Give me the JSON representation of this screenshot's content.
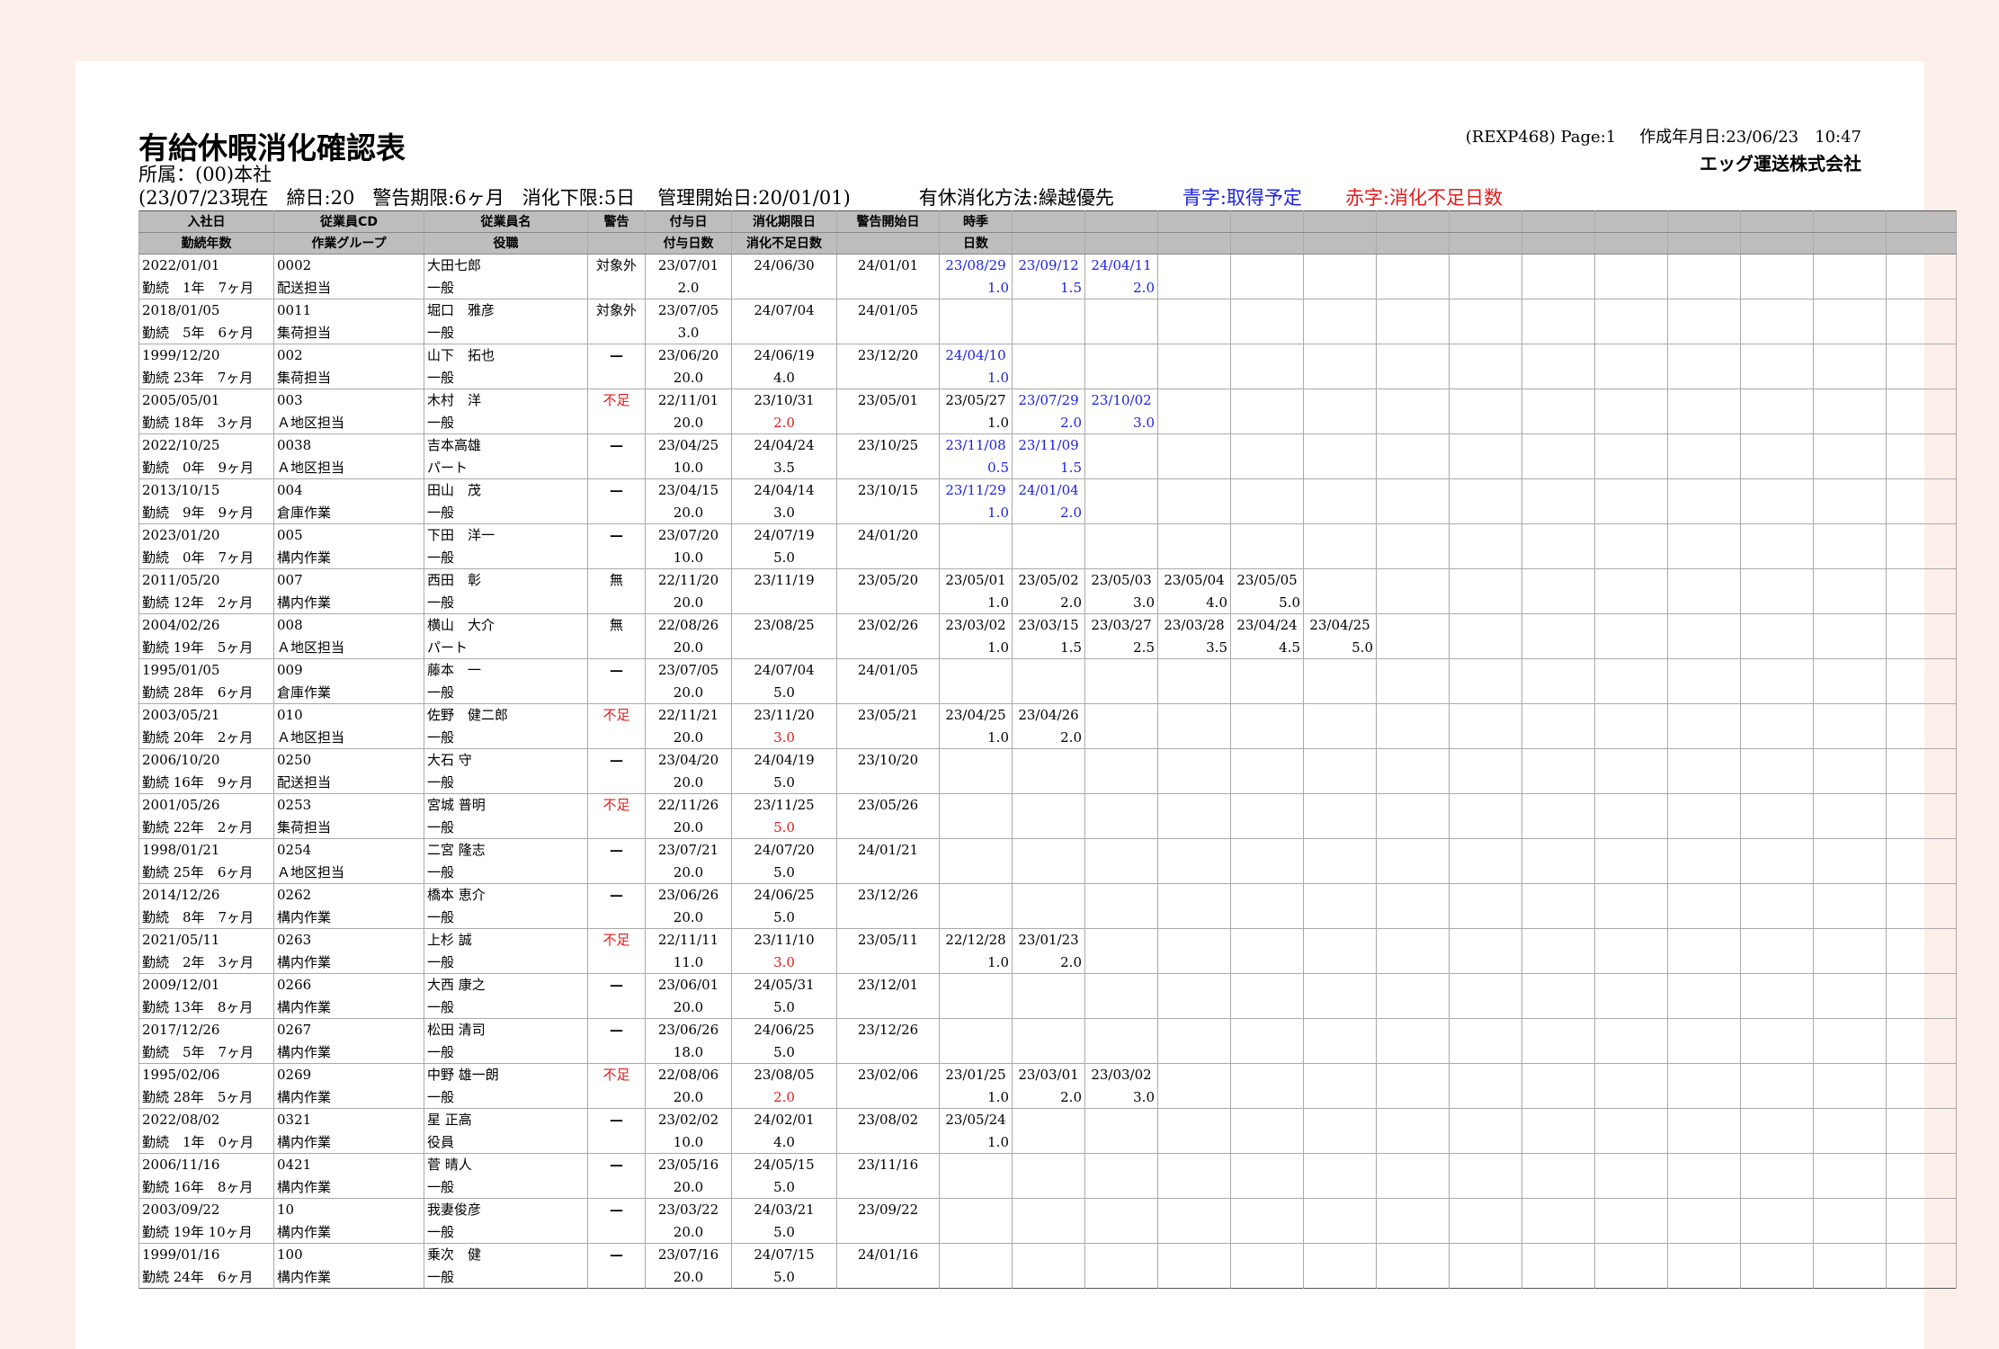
{
  "report": {
    "title": "有給休暇消化確認表",
    "department": "所属：(00)本社",
    "as_of": "(23/07/23現在",
    "closing_day": "締日:20",
    "warning_period": "警告期限:6ヶ月",
    "min_days": "消化下限:5日",
    "mgmt_start": "管理開始日:20/01/01)",
    "method": "有休消化方法:繰越優先",
    "legend_blue": "青字:取得予定",
    "legend_red": "赤字:消化不足日数",
    "report_id": "(REXP468) Page:1",
    "created": "作成年月日:23/06/23　10:47",
    "company": "エッグ運送株式会社",
    "colors": {
      "blue": "#1c22e0",
      "red": "#e11b1b",
      "header_bg": "#bdbdbd",
      "page_bg": "#fcefea"
    }
  },
  "headers": {
    "row1": [
      "入社日",
      "従業員CD",
      "従業員名",
      "警告",
      "付与日",
      "消化期限日",
      "警告開始日",
      "時季"
    ],
    "row2": [
      "勤続年数",
      "作業グループ",
      "役職",
      "",
      "付与日数",
      "消化不足日数",
      "",
      "日数"
    ]
  },
  "employees": [
    {
      "hire": "2022/01/01",
      "tenure": "勤続　1年　7ヶ月",
      "cd": "0002",
      "group": "配送担当",
      "name": "大田七郎",
      "title": "一般",
      "warn": "対象外",
      "warn_type": "text",
      "grant": "23/07/01",
      "grant_days": "2.0",
      "limit": "24/06/30",
      "short": "",
      "short_red": false,
      "wstart": "24/01/01",
      "seasons": [
        {
          "d": "23/08/29",
          "n": "1.0",
          "blue": true
        },
        {
          "d": "23/09/12",
          "n": "1.5",
          "blue": true
        },
        {
          "d": "24/04/11",
          "n": "2.0",
          "blue": true
        }
      ]
    },
    {
      "hire": "2018/01/05",
      "tenure": "勤続　5年　6ヶ月",
      "cd": "0011",
      "group": "集荷担当",
      "name": "堀口　雅彦",
      "title": "一般",
      "warn": "対象外",
      "warn_type": "text",
      "grant": "23/07/05",
      "grant_days": "3.0",
      "limit": "24/07/04",
      "short": "",
      "short_red": false,
      "wstart": "24/01/05",
      "seasons": []
    },
    {
      "hire": "1999/12/20",
      "tenure": "勤続 23年　7ヶ月",
      "cd": "002",
      "group": "集荷担当",
      "name": "山下　拓也",
      "title": "一般",
      "warn": "—",
      "warn_type": "dash",
      "grant": "23/06/20",
      "grant_days": "20.0",
      "limit": "24/06/19",
      "short": "4.0",
      "short_red": false,
      "wstart": "23/12/20",
      "seasons": [
        {
          "d": "24/04/10",
          "n": "1.0",
          "blue": true
        }
      ]
    },
    {
      "hire": "2005/05/01",
      "tenure": "勤続 18年　3ヶ月",
      "cd": "003",
      "group": "Ａ地区担当",
      "name": "木村　洋",
      "title": "一般",
      "warn": "不足",
      "warn_type": "red",
      "grant": "22/11/01",
      "grant_days": "20.0",
      "limit": "23/10/31",
      "short": "2.0",
      "short_red": true,
      "wstart": "23/05/01",
      "seasons": [
        {
          "d": "23/05/27",
          "n": "1.0",
          "blue": false
        },
        {
          "d": "23/07/29",
          "n": "2.0",
          "blue": true
        },
        {
          "d": "23/10/02",
          "n": "3.0",
          "blue": true
        }
      ]
    },
    {
      "hire": "2022/10/25",
      "tenure": "勤続　0年　9ヶ月",
      "cd": "0038",
      "group": "Ａ地区担当",
      "name": "吉本高雄",
      "title": "パート",
      "warn": "—",
      "warn_type": "dash",
      "grant": "23/04/25",
      "grant_days": "10.0",
      "limit": "24/04/24",
      "short": "3.5",
      "short_red": false,
      "wstart": "23/10/25",
      "seasons": [
        {
          "d": "23/11/08",
          "n": "0.5",
          "blue": true
        },
        {
          "d": "23/11/09",
          "n": "1.5",
          "blue": true
        }
      ]
    },
    {
      "hire": "2013/10/15",
      "tenure": "勤続　9年　9ヶ月",
      "cd": "004",
      "group": "倉庫作業",
      "name": "田山　茂",
      "title": "一般",
      "warn": "—",
      "warn_type": "dash",
      "grant": "23/04/15",
      "grant_days": "20.0",
      "limit": "24/04/14",
      "short": "3.0",
      "short_red": false,
      "wstart": "23/10/15",
      "seasons": [
        {
          "d": "23/11/29",
          "n": "1.0",
          "blue": true
        },
        {
          "d": "24/01/04",
          "n": "2.0",
          "blue": true
        }
      ]
    },
    {
      "hire": "2023/01/20",
      "tenure": "勤続　0年　7ヶ月",
      "cd": "005",
      "group": "構内作業",
      "name": "下田　洋一",
      "title": "一般",
      "warn": "—",
      "warn_type": "dash",
      "grant": "23/07/20",
      "grant_days": "10.0",
      "limit": "24/07/19",
      "short": "5.0",
      "short_red": false,
      "wstart": "24/01/20",
      "seasons": []
    },
    {
      "hire": "2011/05/20",
      "tenure": "勤続 12年　2ヶ月",
      "cd": "007",
      "group": "構内作業",
      "name": "西田　彰",
      "title": "一般",
      "warn": "無",
      "warn_type": "text",
      "grant": "22/11/20",
      "grant_days": "20.0",
      "limit": "23/11/19",
      "short": "",
      "short_red": false,
      "wstart": "23/05/20",
      "seasons": [
        {
          "d": "23/05/01",
          "n": "1.0",
          "blue": false
        },
        {
          "d": "23/05/02",
          "n": "2.0",
          "blue": false
        },
        {
          "d": "23/05/03",
          "n": "3.0",
          "blue": false
        },
        {
          "d": "23/05/04",
          "n": "4.0",
          "blue": false
        },
        {
          "d": "23/05/05",
          "n": "5.0",
          "blue": false
        }
      ]
    },
    {
      "hire": "2004/02/26",
      "tenure": "勤続 19年　5ヶ月",
      "cd": "008",
      "group": "Ａ地区担当",
      "name": "横山　大介",
      "title": "パート",
      "warn": "無",
      "warn_type": "text",
      "grant": "22/08/26",
      "grant_days": "20.0",
      "limit": "23/08/25",
      "short": "",
      "short_red": false,
      "wstart": "23/02/26",
      "seasons": [
        {
          "d": "23/03/02",
          "n": "1.0",
          "blue": false
        },
        {
          "d": "23/03/15",
          "n": "1.5",
          "blue": false
        },
        {
          "d": "23/03/27",
          "n": "2.5",
          "blue": false
        },
        {
          "d": "23/03/28",
          "n": "3.5",
          "blue": false
        },
        {
          "d": "23/04/24",
          "n": "4.5",
          "blue": false
        },
        {
          "d": "23/04/25",
          "n": "5.0",
          "blue": false
        }
      ]
    },
    {
      "hire": "1995/01/05",
      "tenure": "勤続 28年　6ヶ月",
      "cd": "009",
      "group": "倉庫作業",
      "name": "藤本　一",
      "title": "一般",
      "warn": "—",
      "warn_type": "dash",
      "grant": "23/07/05",
      "grant_days": "20.0",
      "limit": "24/07/04",
      "short": "5.0",
      "short_red": false,
      "wstart": "24/01/05",
      "seasons": []
    },
    {
      "hire": "2003/05/21",
      "tenure": "勤続 20年　2ヶ月",
      "cd": "010",
      "group": "Ａ地区担当",
      "name": "佐野　健二郎",
      "title": "一般",
      "warn": "不足",
      "warn_type": "red",
      "grant": "22/11/21",
      "grant_days": "20.0",
      "limit": "23/11/20",
      "short": "3.0",
      "short_red": true,
      "wstart": "23/05/21",
      "seasons": [
        {
          "d": "23/04/25",
          "n": "1.0",
          "blue": false
        },
        {
          "d": "23/04/26",
          "n": "2.0",
          "blue": false
        }
      ]
    },
    {
      "hire": "2006/10/20",
      "tenure": "勤続 16年　9ヶ月",
      "cd": "0250",
      "group": "配送担当",
      "name": "大石 守",
      "title": "一般",
      "warn": "—",
      "warn_type": "dash",
      "grant": "23/04/20",
      "grant_days": "20.0",
      "limit": "24/04/19",
      "short": "5.0",
      "short_red": false,
      "wstart": "23/10/20",
      "seasons": []
    },
    {
      "hire": "2001/05/26",
      "tenure": "勤続 22年　2ヶ月",
      "cd": "0253",
      "group": "集荷担当",
      "name": "宮城 普明",
      "title": "一般",
      "warn": "不足",
      "warn_type": "red",
      "grant": "22/11/26",
      "grant_days": "20.0",
      "limit": "23/11/25",
      "short": "5.0",
      "short_red": true,
      "wstart": "23/05/26",
      "seasons": []
    },
    {
      "hire": "1998/01/21",
      "tenure": "勤続 25年　6ヶ月",
      "cd": "0254",
      "group": "Ａ地区担当",
      "name": "二宮 隆志",
      "title": "一般",
      "warn": "—",
      "warn_type": "dash",
      "grant": "23/07/21",
      "grant_days": "20.0",
      "limit": "24/07/20",
      "short": "5.0",
      "short_red": false,
      "wstart": "24/01/21",
      "seasons": []
    },
    {
      "hire": "2014/12/26",
      "tenure": "勤続　8年　7ヶ月",
      "cd": "0262",
      "group": "構内作業",
      "name": "橋本 恵介",
      "title": "一般",
      "warn": "—",
      "warn_type": "dash",
      "grant": "23/06/26",
      "grant_days": "20.0",
      "limit": "24/06/25",
      "short": "5.0",
      "short_red": false,
      "wstart": "23/12/26",
      "seasons": []
    },
    {
      "hire": "2021/05/11",
      "tenure": "勤続　2年　3ヶ月",
      "cd": "0263",
      "group": "構内作業",
      "name": "上杉 誠",
      "title": "一般",
      "warn": "不足",
      "warn_type": "red",
      "grant": "22/11/11",
      "grant_days": "11.0",
      "limit": "23/11/10",
      "short": "3.0",
      "short_red": true,
      "wstart": "23/05/11",
      "seasons": [
        {
          "d": "22/12/28",
          "n": "1.0",
          "blue": false
        },
        {
          "d": "23/01/23",
          "n": "2.0",
          "blue": false
        }
      ]
    },
    {
      "hire": "2009/12/01",
      "tenure": "勤続 13年　8ヶ月",
      "cd": "0266",
      "group": "構内作業",
      "name": "大西 康之",
      "title": "一般",
      "warn": "—",
      "warn_type": "dash",
      "grant": "23/06/01",
      "grant_days": "20.0",
      "limit": "24/05/31",
      "short": "5.0",
      "short_red": false,
      "wstart": "23/12/01",
      "seasons": []
    },
    {
      "hire": "2017/12/26",
      "tenure": "勤続　5年　7ヶ月",
      "cd": "0267",
      "group": "構内作業",
      "name": "松田 清司",
      "title": "一般",
      "warn": "—",
      "warn_type": "dash",
      "grant": "23/06/26",
      "grant_days": "18.0",
      "limit": "24/06/25",
      "short": "5.0",
      "short_red": false,
      "wstart": "23/12/26",
      "seasons": []
    },
    {
      "hire": "1995/02/06",
      "tenure": "勤続 28年　5ヶ月",
      "cd": "0269",
      "group": "構内作業",
      "name": "中野 雄一朗",
      "title": "一般",
      "warn": "不足",
      "warn_type": "red",
      "grant": "22/08/06",
      "grant_days": "20.0",
      "limit": "23/08/05",
      "short": "2.0",
      "short_red": true,
      "wstart": "23/02/06",
      "seasons": [
        {
          "d": "23/01/25",
          "n": "1.0",
          "blue": false
        },
        {
          "d": "23/03/01",
          "n": "2.0",
          "blue": false
        },
        {
          "d": "23/03/02",
          "n": "3.0",
          "blue": false
        }
      ]
    },
    {
      "hire": "2022/08/02",
      "tenure": "勤続　1年　0ヶ月",
      "cd": "0321",
      "group": "構内作業",
      "name": "星 正高",
      "title": "役員",
      "warn": "—",
      "warn_type": "dash",
      "grant": "23/02/02",
      "grant_days": "10.0",
      "limit": "24/02/01",
      "short": "4.0",
      "short_red": false,
      "wstart": "23/08/02",
      "seasons": [
        {
          "d": "23/05/24",
          "n": "1.0",
          "blue": false
        }
      ]
    },
    {
      "hire": "2006/11/16",
      "tenure": "勤続 16年　8ヶ月",
      "cd": "0421",
      "group": "構内作業",
      "name": "菅 晴人",
      "title": "一般",
      "warn": "—",
      "warn_type": "dash",
      "grant": "23/05/16",
      "grant_days": "20.0",
      "limit": "24/05/15",
      "short": "5.0",
      "short_red": false,
      "wstart": "23/11/16",
      "seasons": []
    },
    {
      "hire": "2003/09/22",
      "tenure": "勤続 19年 10ヶ月",
      "cd": "10",
      "group": "構内作業",
      "name": "我妻俊彦",
      "title": "一般",
      "warn": "—",
      "warn_type": "dash",
      "grant": "23/03/22",
      "grant_days": "20.0",
      "limit": "24/03/21",
      "short": "5.0",
      "short_red": false,
      "wstart": "23/09/22",
      "seasons": []
    },
    {
      "hire": "1999/01/16",
      "tenure": "勤続 24年　6ヶ月",
      "cd": "100",
      "group": "構内作業",
      "name": "乗次　健",
      "title": "一般",
      "warn": "—",
      "warn_type": "dash",
      "grant": "23/07/16",
      "grant_days": "20.0",
      "limit": "24/07/15",
      "short": "5.0",
      "short_red": false,
      "wstart": "24/01/16",
      "seasons": []
    }
  ]
}
